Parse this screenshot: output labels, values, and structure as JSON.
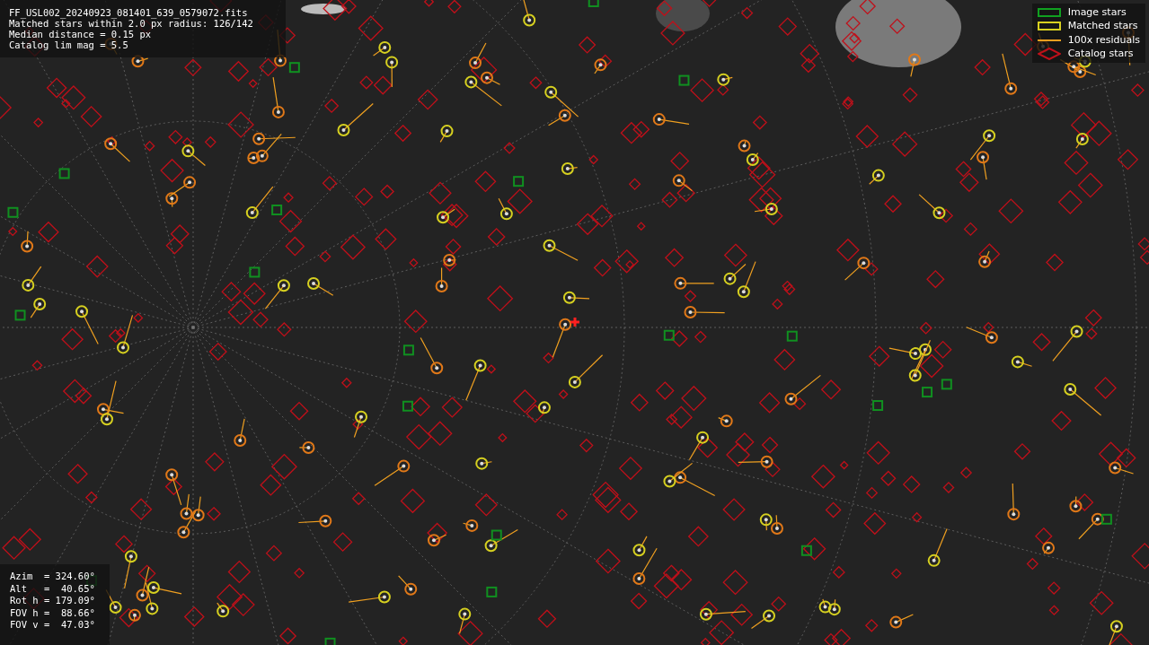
{
  "info": {
    "lines": [
      "FF_USL002_20240923_081401_639_0579072.fits",
      "Matched stars within 2.0 px radius: 126/142",
      "Median distance = 0.15 px",
      "Catalog lim mag = 5.5"
    ]
  },
  "legend": [
    {
      "label": "Image stars"
    },
    {
      "kind": "matched",
      "label": "Matched stars"
    },
    {
      "kind": "residual",
      "label": "100x residuals"
    },
    {
      "kind": "catalog",
      "label": "Catalog stars"
    }
  ],
  "pointing": {
    "lines": [
      "Azim  = 324.60°",
      "Alt   =  40.65°",
      "Rot h = 179.09°",
      "FOV h =  88.66°",
      "FOV v =  47.03°"
    ]
  }
}
